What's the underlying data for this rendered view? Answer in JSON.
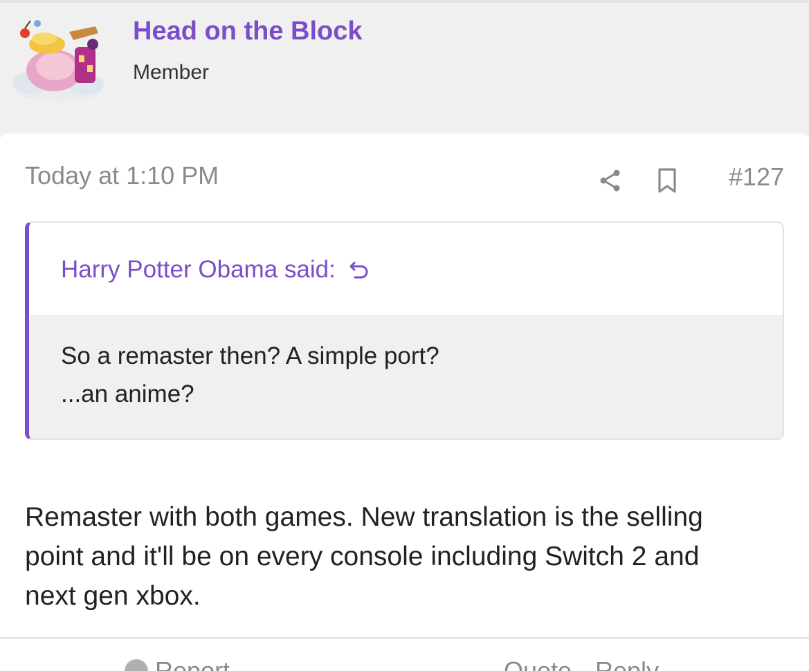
{
  "author": {
    "username": "Head on the Block",
    "user_title": "Member",
    "avatar_icon": "avatar-image"
  },
  "post": {
    "timestamp": "Today at 1:10 PM",
    "number": "#127",
    "share_icon": "share-icon",
    "bookmark_icon": "bookmark-icon"
  },
  "quote": {
    "attribution": "Harry Potter Obama said:",
    "jump_icon": "undo-arrow-icon",
    "lines": [
      "So a remaster then? A simple port?",
      "...an anime?"
    ]
  },
  "body": {
    "lines": [
      "Remaster with both games. New translation is the selling",
      "point and it'll be on every console including Switch 2 and",
      "next gen xbox."
    ]
  },
  "footer": {
    "report_label": "Report",
    "quote_label": "Quote",
    "reply_label": "Reply"
  },
  "colors": {
    "accent": "#7c4dc9",
    "muted_text": "#8a8a8a",
    "page_bg": "#f0f0f0",
    "card_bg": "#ffffff"
  }
}
